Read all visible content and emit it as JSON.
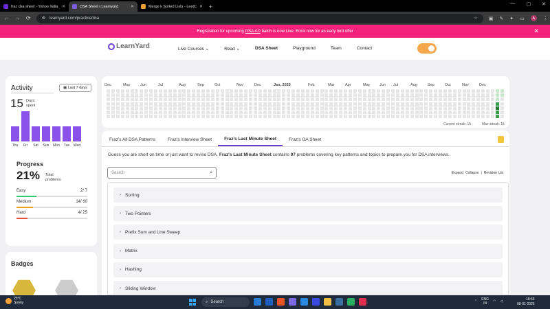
{
  "browser": {
    "tabs": [
      {
        "label": "fraz dsa sheet - Yahoo India Se",
        "color": "#6a2bd9"
      },
      {
        "label": "DSA Sheet | Learnyard",
        "color": "#7b5ce0",
        "active": true
      },
      {
        "label": "Merge k Sorted Lists - LeetCod",
        "color": "#f0a030"
      }
    ],
    "url": "learnyard.com/practice/dsa"
  },
  "banner": {
    "pre": "Registration for upcoming",
    "link": "DSA 4.0",
    "post": "batch is now Live. Enrol now for an early bird offer"
  },
  "header": {
    "logo_text": "LearnYard",
    "menu": [
      "Live Courses",
      "Read",
      "DSA Sheet",
      "Playground",
      "Team",
      "Contact"
    ]
  },
  "activity": {
    "title": "Activity",
    "filter": "Last 7 days",
    "days_count": "15",
    "days_label_1": "Days",
    "days_label_2": "spent",
    "days": [
      {
        "label": "Thu",
        "value": 1
      },
      {
        "label": "Fri",
        "value": 2
      },
      {
        "label": "Sat",
        "value": 1
      },
      {
        "label": "Sun",
        "value": 1
      },
      {
        "label": "Mon",
        "value": 1
      },
      {
        "label": "Tue",
        "value": 1
      },
      {
        "label": "Wed",
        "value": 1
      }
    ]
  },
  "progress": {
    "title": "Progress",
    "percent": "21%",
    "label_1": "Total",
    "label_2": "problems",
    "items": [
      {
        "name": "Easy",
        "value": "2/ 7",
        "fraction": 0.286,
        "color": "#2ecc71"
      },
      {
        "name": "Medium",
        "value": "14/ 60",
        "fraction": 0.233,
        "color": "#f39c12"
      },
      {
        "name": "Hard",
        "value": "4/ 25",
        "fraction": 0.16,
        "color": "#e74c3c"
      }
    ]
  },
  "badges": {
    "title": "Badges"
  },
  "heatmap": {
    "months": [
      "Dec",
      "Jan",
      "Feb",
      "Mar",
      "Apr",
      "May",
      "Jun",
      "Jul",
      "Aug",
      "Sep",
      "Oct",
      "Nov",
      "Dec"
    ],
    "highlight_label": "Jan, 2025",
    "current_streak_label": "Current streak:",
    "current_streak": "15",
    "max_streak_label": "Max streak:",
    "max_streak": "15"
  },
  "sheet_tabs": [
    "Fraz's All DSA Patterns",
    "Fraz's Interview Sheet",
    "Fraz's Last Minute Sheet",
    "Fraz's OA Sheet"
  ],
  "description": {
    "pre": "Guess you are short on time or just want to revise DSA. ",
    "bold1": "Fraz's Last Minute Sheet",
    "mid": " contains ",
    "bold2": "97",
    "post": " problems covering key patterns and topics to prepare you for DSA interviews."
  },
  "search": {
    "placeholder": "Search"
  },
  "list_actions": [
    "Expand",
    "Collapse",
    "|",
    "Revision List"
  ],
  "topics": [
    "Sorting",
    "Two Pointers",
    "Prefix Sum and Line Sweep",
    "Matrix",
    "Hashing",
    "Sliding Window"
  ],
  "taskbar": {
    "temp": "23°C",
    "weather": "Sunny",
    "search": "Search",
    "lang_1": "ENG",
    "lang_2": "IN",
    "time": "18:55",
    "date": "08-01-2025"
  }
}
